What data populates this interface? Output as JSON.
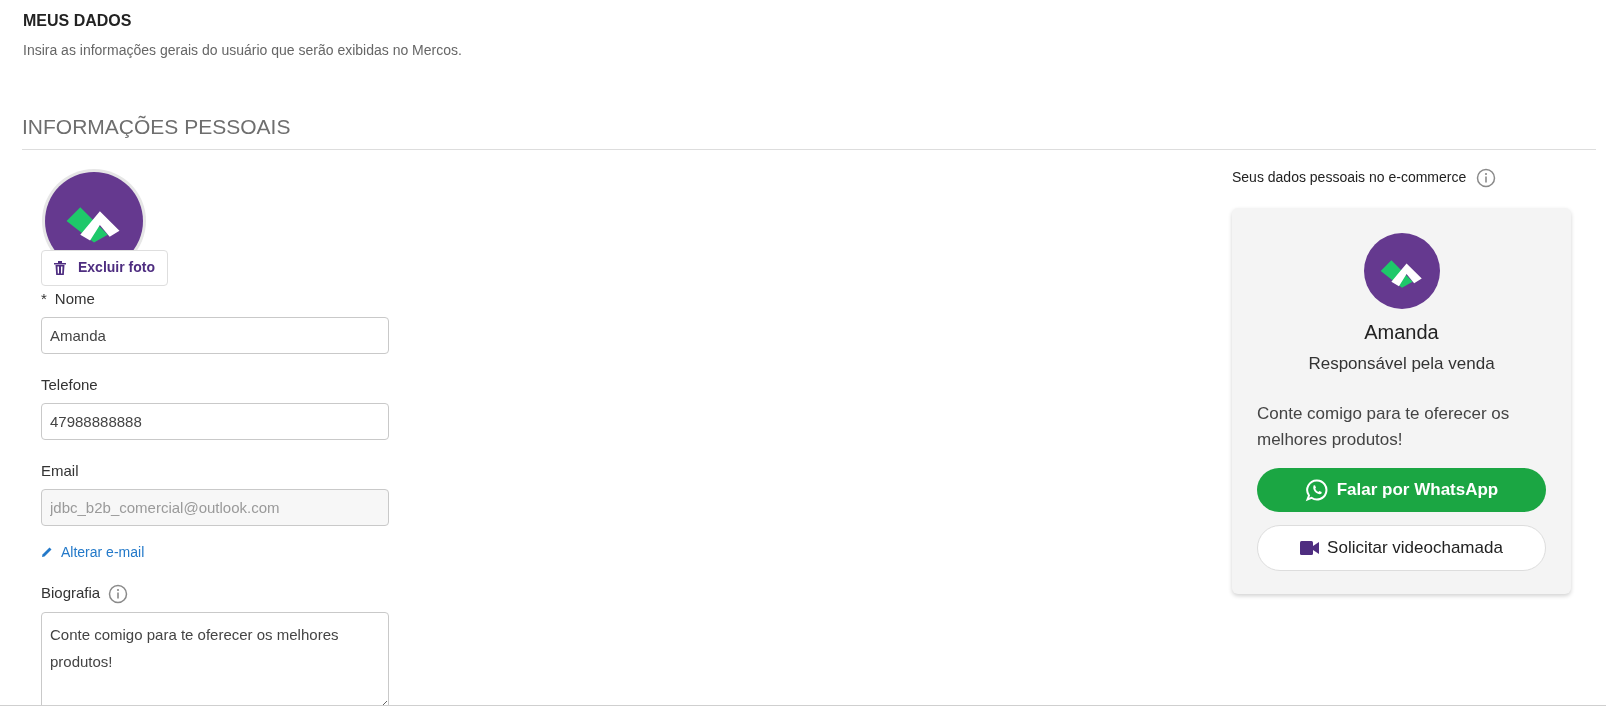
{
  "header": {
    "title": "MEUS DADOS",
    "subtitle": "Insira as informações gerais do usuário que serão exibidas no Mercos."
  },
  "section_title": "INFORMAÇÕES PESSOAIS",
  "photo": {
    "remove_button": "Excluir foto"
  },
  "fields": [
    {
      "kind": "input",
      "required_mark": "*",
      "label": "Nome",
      "value": "Amanda",
      "disabled": false
    },
    {
      "kind": "input",
      "label": "Telefone",
      "value": "47988888888",
      "disabled": false
    },
    {
      "kind": "input",
      "label": "Email",
      "value": "jdbc_b2b_comercial@outlook.com",
      "disabled": true
    },
    {
      "kind": "link",
      "label": "Alterar e-mail"
    },
    {
      "kind": "textarea",
      "label": "Biografia",
      "value": "Conte comigo para te oferecer os melhores produtos!",
      "disabled": false
    }
  ],
  "preview": {
    "title": "Seus dados pessoais no e-commerce",
    "name": "Amanda",
    "role": "Responsável pela venda",
    "bio": "Conte comigo para te oferecer os melhores produtos!",
    "buttons": [
      {
        "kind": "whatsapp",
        "label": "Falar por WhatsApp"
      },
      {
        "kind": "video",
        "label": "Solicitar videochamada"
      }
    ]
  }
}
